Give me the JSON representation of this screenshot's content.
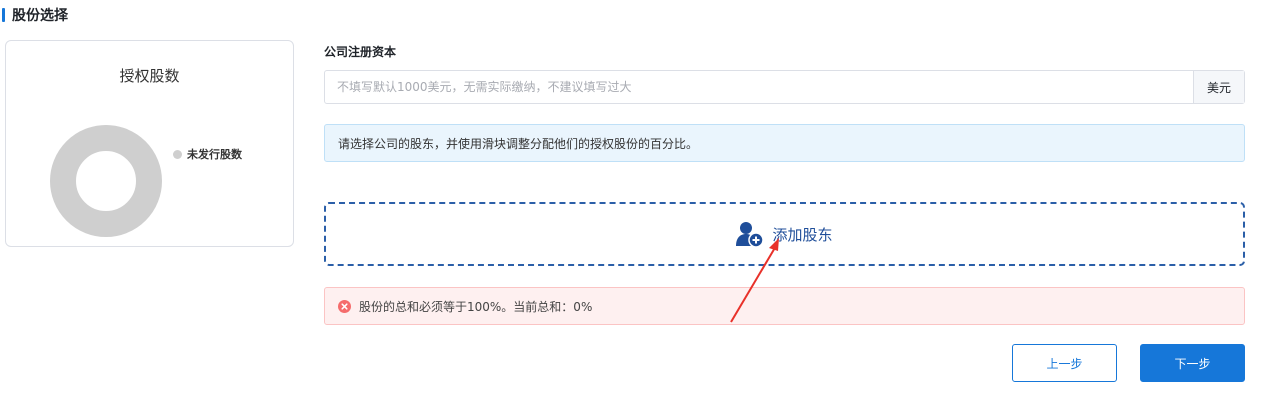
{
  "section": {
    "title": "股份选择"
  },
  "chart_data": {
    "type": "pie",
    "title": "授权股数",
    "categories": [
      "未发行股数"
    ],
    "values": [
      100
    ],
    "colors": [
      "#cfcfcf"
    ],
    "legend": "right"
  },
  "form": {
    "capital_label": "公司注册资本",
    "capital_value": "",
    "capital_placeholder": "不填写默认1000美元，无需实际缴纳，不建议填写过大",
    "capital_suffix": "美元"
  },
  "info_alert": {
    "text": "请选择公司的股东，并使用滑块调整分配他们的授权股份的百分比。"
  },
  "add_shareholder": {
    "label": "添加股东",
    "icon": "add-user-icon"
  },
  "error_alert": {
    "text": "股份的总和必须等于100%。当前总和：0%",
    "icon": "error-circle-icon"
  },
  "buttons": {
    "prev": "上一步",
    "next": "下一步"
  },
  "colors": {
    "primary": "#1677d9",
    "dashed_border": "#2b5fa8",
    "error": "#f56c6c",
    "info_bg": "#eaf5fd",
    "error_bg": "#fef0f0",
    "donut": "#cfcfcf",
    "annotation_arrow": "#e8312a"
  }
}
